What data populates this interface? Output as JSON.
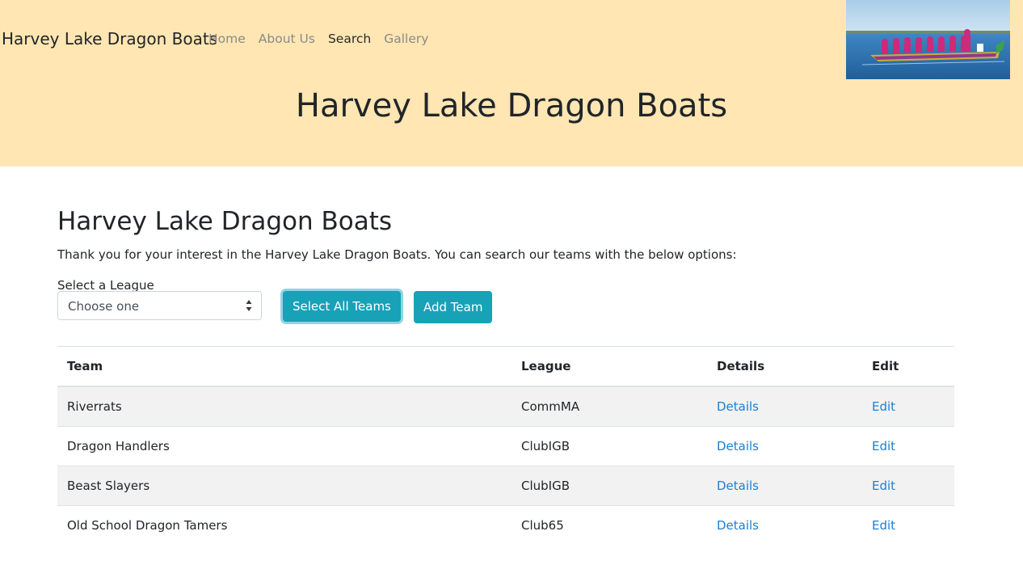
{
  "navbar": {
    "brand": "Harvey Lake Dragon Boats",
    "links": [
      {
        "label": "Home"
      },
      {
        "label": "About Us"
      },
      {
        "label": "Search"
      },
      {
        "label": "Gallery"
      }
    ],
    "active_link": "Search"
  },
  "hero": {
    "title": "Harvey Lake Dragon Boats"
  },
  "main": {
    "heading": "Harvey Lake Dragon Boats",
    "intro": "Thank you for your interest in the Harvey Lake Dragon Boats. You can search our teams with the below options:",
    "league_label": "Select a League",
    "league_select_value": "Choose one",
    "select_all_button": "Select All Teams",
    "add_team_button": "Add Team"
  },
  "table": {
    "headers": [
      "Team",
      "League",
      "Details",
      "Edit"
    ],
    "rows": [
      {
        "team": "Riverrats",
        "league": "CommMA",
        "details": "Details",
        "edit": "Edit"
      },
      {
        "team": "Dragon Handlers",
        "league": "ClubIGB",
        "details": "Details",
        "edit": "Edit"
      },
      {
        "team": "Beast Slayers",
        "league": "ClubIGB",
        "details": "Details",
        "edit": "Edit"
      },
      {
        "team": "Old School Dragon Tamers",
        "league": "Club65",
        "details": "Details",
        "edit": "Edit"
      }
    ]
  },
  "colors": {
    "header_bg": "#ffe6b3",
    "button": "#17a2b8",
    "link": "#1a7fd4",
    "stripe": "#f2f2f2"
  }
}
